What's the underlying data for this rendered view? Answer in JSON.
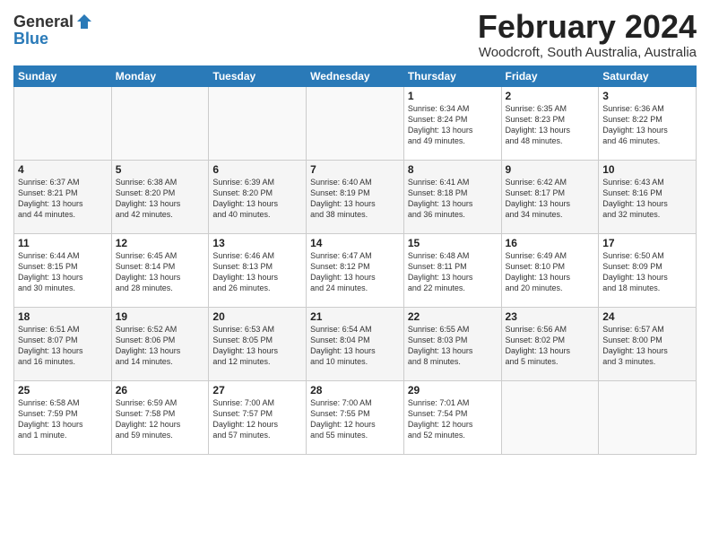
{
  "header": {
    "logo_general": "General",
    "logo_blue": "Blue",
    "month": "February 2024",
    "location": "Woodcroft, South Australia, Australia"
  },
  "weekdays": [
    "Sunday",
    "Monday",
    "Tuesday",
    "Wednesday",
    "Thursday",
    "Friday",
    "Saturday"
  ],
  "weeks": [
    [
      {
        "day": "",
        "info": ""
      },
      {
        "day": "",
        "info": ""
      },
      {
        "day": "",
        "info": ""
      },
      {
        "day": "",
        "info": ""
      },
      {
        "day": "1",
        "info": "Sunrise: 6:34 AM\nSunset: 8:24 PM\nDaylight: 13 hours\nand 49 minutes."
      },
      {
        "day": "2",
        "info": "Sunrise: 6:35 AM\nSunset: 8:23 PM\nDaylight: 13 hours\nand 48 minutes."
      },
      {
        "day": "3",
        "info": "Sunrise: 6:36 AM\nSunset: 8:22 PM\nDaylight: 13 hours\nand 46 minutes."
      }
    ],
    [
      {
        "day": "4",
        "info": "Sunrise: 6:37 AM\nSunset: 8:21 PM\nDaylight: 13 hours\nand 44 minutes."
      },
      {
        "day": "5",
        "info": "Sunrise: 6:38 AM\nSunset: 8:20 PM\nDaylight: 13 hours\nand 42 minutes."
      },
      {
        "day": "6",
        "info": "Sunrise: 6:39 AM\nSunset: 8:20 PM\nDaylight: 13 hours\nand 40 minutes."
      },
      {
        "day": "7",
        "info": "Sunrise: 6:40 AM\nSunset: 8:19 PM\nDaylight: 13 hours\nand 38 minutes."
      },
      {
        "day": "8",
        "info": "Sunrise: 6:41 AM\nSunset: 8:18 PM\nDaylight: 13 hours\nand 36 minutes."
      },
      {
        "day": "9",
        "info": "Sunrise: 6:42 AM\nSunset: 8:17 PM\nDaylight: 13 hours\nand 34 minutes."
      },
      {
        "day": "10",
        "info": "Sunrise: 6:43 AM\nSunset: 8:16 PM\nDaylight: 13 hours\nand 32 minutes."
      }
    ],
    [
      {
        "day": "11",
        "info": "Sunrise: 6:44 AM\nSunset: 8:15 PM\nDaylight: 13 hours\nand 30 minutes."
      },
      {
        "day": "12",
        "info": "Sunrise: 6:45 AM\nSunset: 8:14 PM\nDaylight: 13 hours\nand 28 minutes."
      },
      {
        "day": "13",
        "info": "Sunrise: 6:46 AM\nSunset: 8:13 PM\nDaylight: 13 hours\nand 26 minutes."
      },
      {
        "day": "14",
        "info": "Sunrise: 6:47 AM\nSunset: 8:12 PM\nDaylight: 13 hours\nand 24 minutes."
      },
      {
        "day": "15",
        "info": "Sunrise: 6:48 AM\nSunset: 8:11 PM\nDaylight: 13 hours\nand 22 minutes."
      },
      {
        "day": "16",
        "info": "Sunrise: 6:49 AM\nSunset: 8:10 PM\nDaylight: 13 hours\nand 20 minutes."
      },
      {
        "day": "17",
        "info": "Sunrise: 6:50 AM\nSunset: 8:09 PM\nDaylight: 13 hours\nand 18 minutes."
      }
    ],
    [
      {
        "day": "18",
        "info": "Sunrise: 6:51 AM\nSunset: 8:07 PM\nDaylight: 13 hours\nand 16 minutes."
      },
      {
        "day": "19",
        "info": "Sunrise: 6:52 AM\nSunset: 8:06 PM\nDaylight: 13 hours\nand 14 minutes."
      },
      {
        "day": "20",
        "info": "Sunrise: 6:53 AM\nSunset: 8:05 PM\nDaylight: 13 hours\nand 12 minutes."
      },
      {
        "day": "21",
        "info": "Sunrise: 6:54 AM\nSunset: 8:04 PM\nDaylight: 13 hours\nand 10 minutes."
      },
      {
        "day": "22",
        "info": "Sunrise: 6:55 AM\nSunset: 8:03 PM\nDaylight: 13 hours\nand 8 minutes."
      },
      {
        "day": "23",
        "info": "Sunrise: 6:56 AM\nSunset: 8:02 PM\nDaylight: 13 hours\nand 5 minutes."
      },
      {
        "day": "24",
        "info": "Sunrise: 6:57 AM\nSunset: 8:00 PM\nDaylight: 13 hours\nand 3 minutes."
      }
    ],
    [
      {
        "day": "25",
        "info": "Sunrise: 6:58 AM\nSunset: 7:59 PM\nDaylight: 13 hours\nand 1 minute."
      },
      {
        "day": "26",
        "info": "Sunrise: 6:59 AM\nSunset: 7:58 PM\nDaylight: 12 hours\nand 59 minutes."
      },
      {
        "day": "27",
        "info": "Sunrise: 7:00 AM\nSunset: 7:57 PM\nDaylight: 12 hours\nand 57 minutes."
      },
      {
        "day": "28",
        "info": "Sunrise: 7:00 AM\nSunset: 7:55 PM\nDaylight: 12 hours\nand 55 minutes."
      },
      {
        "day": "29",
        "info": "Sunrise: 7:01 AM\nSunset: 7:54 PM\nDaylight: 12 hours\nand 52 minutes."
      },
      {
        "day": "",
        "info": ""
      },
      {
        "day": "",
        "info": ""
      }
    ]
  ]
}
